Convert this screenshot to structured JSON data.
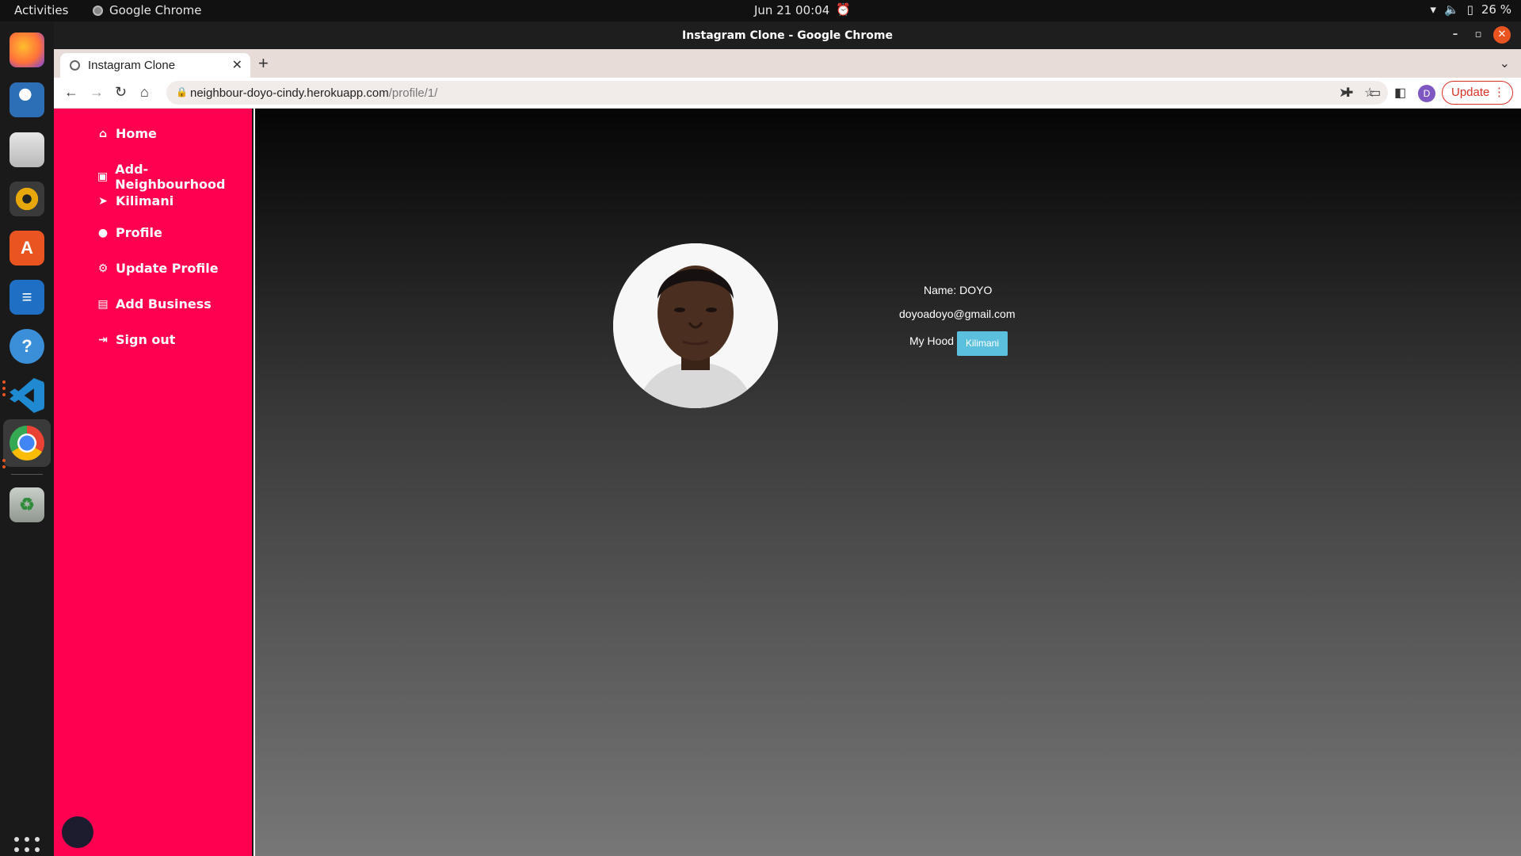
{
  "topbar": {
    "activities": "Activities",
    "app_name": "Google Chrome",
    "clock": "Jun 21  00:04",
    "battery": "26 %"
  },
  "dock": {
    "items": [
      {
        "name": "firefox-icon",
        "color": "#ff7139"
      },
      {
        "name": "thunderbird-icon",
        "color": "#2d6fb6"
      },
      {
        "name": "files-icon",
        "color": "#cfcfcf"
      },
      {
        "name": "rhythmbox-icon",
        "color": "#e8a80c"
      },
      {
        "name": "software-icon",
        "color": "#e95420"
      },
      {
        "name": "writer-icon",
        "color": "#1f6fc5"
      },
      {
        "name": "help-icon",
        "color": "#3a8fd8"
      },
      {
        "name": "vscode-icon",
        "color": "#1f8ad2"
      },
      {
        "name": "chrome-icon",
        "color": "#4285f4"
      },
      {
        "name": "trash-icon",
        "color": "#9aa39a"
      }
    ]
  },
  "window": {
    "title": "Instagram Clone - Google Chrome",
    "tab_title": "Instagram Clone",
    "url_host": "neighbour-doyo-cindy.herokuapp.com",
    "url_path": "/profile/1/",
    "profile_initial": "D",
    "update_label": "Update"
  },
  "sidebar": {
    "color": "#ff0050",
    "items": [
      {
        "label": "Home",
        "icon": "home-icon"
      },
      {
        "label": "Add-Neighbourhood",
        "icon": "contact-icon"
      },
      {
        "label": "Kilimani",
        "icon": "paper-plane-icon"
      },
      {
        "label": "Profile",
        "icon": "user-icon"
      },
      {
        "label": "Update Profile",
        "icon": "gear-icon"
      },
      {
        "label": "Add Business",
        "icon": "briefcase-icon"
      },
      {
        "label": "Sign out",
        "icon": "sign-out-icon"
      }
    ]
  },
  "profile": {
    "name": "Name: DOYO",
    "email": "doyoadoyo@gmail.com",
    "hood_label": "My Hood",
    "hood_button": "Kilimani",
    "hood_button_color": "#5bc0de"
  }
}
